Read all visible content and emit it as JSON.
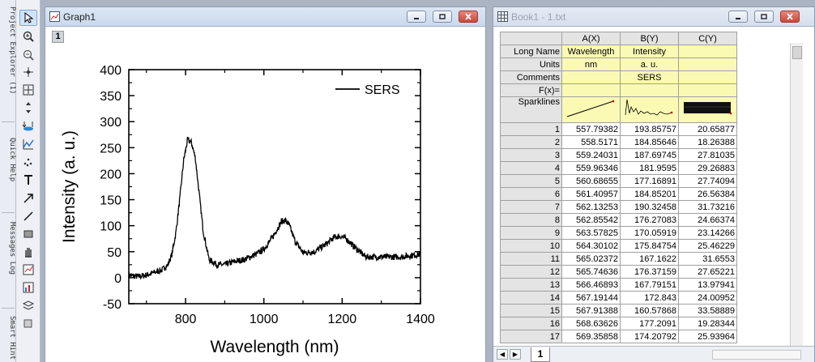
{
  "side_panels": [
    "Project Explorer (1)",
    "Quick Help",
    "Messages Log",
    "Smart Hint"
  ],
  "graph_window": {
    "title": "Graph1",
    "layer": "1"
  },
  "chart_data": {
    "type": "line",
    "xlabel": "Wavelength (nm)",
    "ylabel": "Intensity (a. u.)",
    "xlim": [
      655,
      1400
    ],
    "ylim": [
      -50,
      400
    ],
    "xticks": [
      800,
      1000,
      1200,
      1400
    ],
    "yticks": [
      -50,
      0,
      50,
      100,
      150,
      200,
      250,
      300,
      350,
      400
    ],
    "legend": "top-right",
    "series": [
      {
        "name": "SERS",
        "color": "#000000",
        "x": [
          655,
          680,
          700,
          720,
          740,
          755,
          765,
          775,
          785,
          795,
          805,
          815,
          825,
          835,
          845,
          860,
          880,
          900,
          920,
          950,
          980,
          1000,
          1020,
          1035,
          1045,
          1055,
          1065,
          1080,
          1100,
          1130,
          1160,
          1180,
          1195,
          1210,
          1230,
          1260,
          1300,
          1350,
          1400
        ],
        "y": [
          5,
          2,
          5,
          10,
          15,
          25,
          45,
          85,
          150,
          225,
          265,
          260,
          230,
          160,
          90,
          35,
          25,
          25,
          30,
          35,
          45,
          55,
          75,
          95,
          108,
          110,
          100,
          70,
          48,
          50,
          65,
          78,
          80,
          75,
          60,
          40,
          40,
          40,
          45
        ]
      }
    ]
  },
  "book_window": {
    "title": "Book1 - 1.txt",
    "columns": [
      "A(X)",
      "B(Y)",
      "C(Y)"
    ],
    "meta_rows": [
      {
        "label": "Long Name",
        "values": [
          "Wavelength",
          "Intensity",
          ""
        ]
      },
      {
        "label": "Units",
        "values": [
          "nm",
          "a. u.",
          ""
        ]
      },
      {
        "label": "Comments",
        "values": [
          "",
          "SERS",
          ""
        ]
      },
      {
        "label": "F(x)=",
        "values": [
          "",
          "",
          ""
        ]
      }
    ],
    "sparklines_label": "Sparklines",
    "rows": [
      [
        "1",
        "557.79382",
        "193.85757",
        "20.65877"
      ],
      [
        "2",
        "558.5171",
        "184.85646",
        "18.26388"
      ],
      [
        "3",
        "559.24031",
        "187.69745",
        "27.81035"
      ],
      [
        "4",
        "559.96346",
        "181.9595",
        "29.26883"
      ],
      [
        "5",
        "560.68655",
        "177.16891",
        "27.74094"
      ],
      [
        "6",
        "561.40957",
        "184.85201",
        "26.56384"
      ],
      [
        "7",
        "562.13253",
        "190.32458",
        "31.73216"
      ],
      [
        "8",
        "562.85542",
        "176.27083",
        "24.66374"
      ],
      [
        "9",
        "563.57825",
        "170.05919",
        "23.14266"
      ],
      [
        "10",
        "564.30102",
        "175.84754",
        "25.46229"
      ],
      [
        "11",
        "565.02372",
        "167.1622",
        "31.6553"
      ],
      [
        "12",
        "565.74636",
        "176.37159",
        "27.65221"
      ],
      [
        "13",
        "566.46893",
        "167.79151",
        "13.97941"
      ],
      [
        "14",
        "567.19144",
        "172.843",
        "24.00952"
      ],
      [
        "15",
        "567.91388",
        "160.57868",
        "33.58889"
      ],
      [
        "16",
        "568.63626",
        "177.2091",
        "19.28344"
      ],
      [
        "17",
        "569.35858",
        "174.20792",
        "25.93964"
      ]
    ],
    "sheet_tab": "1"
  }
}
